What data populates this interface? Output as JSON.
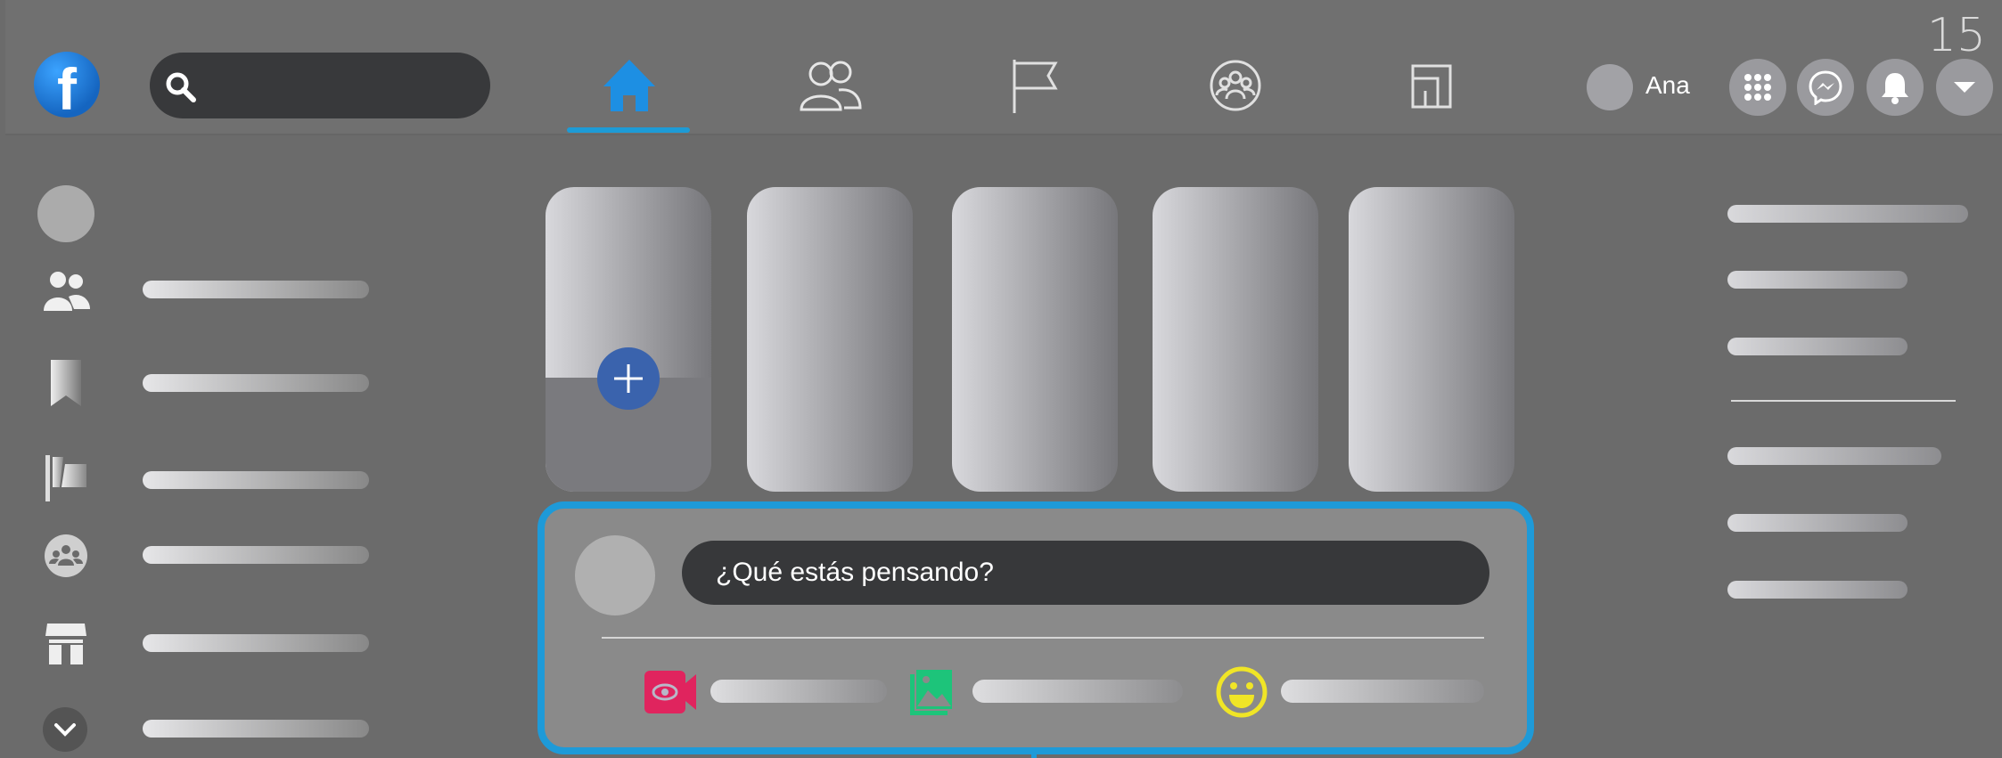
{
  "topbar": {
    "logo_letter": "f",
    "search": {
      "placeholder": ""
    },
    "nav": [
      {
        "name": "home",
        "icon": "home-icon",
        "active": true
      },
      {
        "name": "friends",
        "icon": "friends-icon",
        "active": false
      },
      {
        "name": "pages",
        "icon": "flag-icon",
        "active": false
      },
      {
        "name": "groups",
        "icon": "groups-icon",
        "active": false
      },
      {
        "name": "gaming",
        "icon": "gaming-icon",
        "active": false
      }
    ],
    "user": {
      "name": "Ana"
    },
    "actions": [
      "menu-grid-icon",
      "messenger-icon",
      "bell-icon",
      "caret-down-icon"
    ],
    "step_number": "15"
  },
  "composer": {
    "placeholder": "¿Qué estás pensando?",
    "actions": [
      "live-video-icon",
      "photo-icon",
      "feeling-icon"
    ]
  },
  "colors": {
    "accent": "#1e9ad8",
    "live": "#e0245e",
    "photo": "#1dc47a",
    "feeling": "#f0e526",
    "add_story": "#3a63ad"
  }
}
